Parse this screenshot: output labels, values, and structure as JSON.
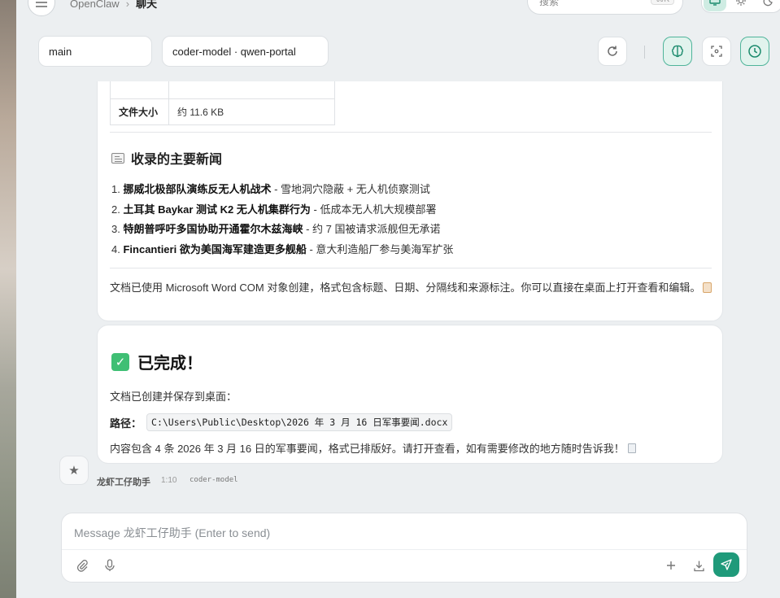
{
  "header": {
    "menu_icon": "menu-icon",
    "breadcrumb_root": "OpenClaw",
    "breadcrumb_sep": "›",
    "breadcrumb_current": "聊天",
    "search_placeholder": "搜索",
    "search_shortcut": "⌘K",
    "mode_buttons": [
      "monitor-icon",
      "sun-icon",
      "moon-icon"
    ]
  },
  "session": {
    "agent": "main",
    "model": "coder-model · qwen-portal",
    "buttons": [
      "refresh-icon",
      "brain-icon",
      "focus-icon",
      "clock-icon"
    ]
  },
  "message1": {
    "table": [
      {
        "key": "文件大小",
        "value": "约 11.6 KB"
      }
    ],
    "section_title": "收录的主要新闻",
    "news": [
      {
        "num": "1. ",
        "title": "挪威北极部队演练反无人机战术",
        "desc": " - 雪地洞穴隐蔽 + 无人机侦察测试"
      },
      {
        "num": "2. ",
        "title": "土耳其 Baykar 测试 K2 无人机集群行为",
        "desc": " - 低成本无人机大规模部署"
      },
      {
        "num": "3. ",
        "title": "特朗普呼吁多国协助开通霍尔木兹海峡",
        "desc": " - 约 7 国被请求派舰但无承诺"
      },
      {
        "num": "4. ",
        "title": "Fincantieri 欲为美国海军建造更多舰船",
        "desc": " - 意大利造船厂参与美海军扩张"
      }
    ],
    "note": "文档已使用 Microsoft Word COM 对象创建，格式包含标题、日期、分隔线和来源标注。你可以直接在桌面上打开查看和编辑。"
  },
  "message2": {
    "title": "已完成！",
    "line1": "文档已创建并保存到桌面：",
    "path_label": "路径：",
    "path_value": "C:\\Users\\Public\\Desktop\\2026 年 3 月 16 日军事要闻.docx",
    "line2": "内容包含 4 条 2026 年 3 月 16 日的军事要闻，格式已排版好。请打开查看，如有需要修改的地方随时告诉我！"
  },
  "meta": {
    "sender": "龙虾工仔助手",
    "time": "1:10",
    "model": "coder-model"
  },
  "composer": {
    "placeholder": "Message 龙虾工仔助手 (Enter to send)",
    "icons": [
      "paperclip-icon",
      "mic-icon",
      "plus-icon",
      "export-icon",
      "send-icon"
    ]
  },
  "colors": {
    "accent": "#1f9a7a",
    "accent_light": "#e1f3ed",
    "background": "#eceff1"
  }
}
